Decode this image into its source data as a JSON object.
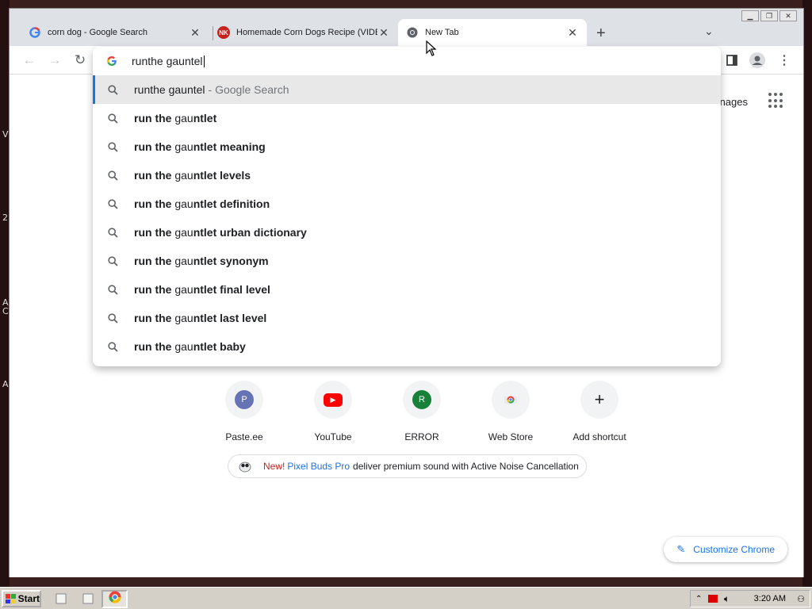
{
  "desktop": {
    "edge_letters": [
      "V",
      "2",
      "A",
      "C",
      "A"
    ]
  },
  "tabs": [
    {
      "title": "corn dog - Google Search",
      "favicon": "google-g-icon"
    },
    {
      "title": "Homemade Corn Dogs Recipe (VIDE",
      "favicon": "nk-favicon-icon",
      "favicon_text": "NK"
    },
    {
      "title": "New Tab",
      "favicon": "chrome-icon"
    }
  ],
  "omnibox": {
    "input_value": "runthe gauntel",
    "first_suggestion": {
      "text": "runthe gauntel",
      "suffix": "- Google Search"
    },
    "suggestions": [
      {
        "bold1": "run the ",
        "norm": "gau",
        "bold2": "ntlet"
      },
      {
        "bold1": "run the ",
        "norm": "gau",
        "bold2": "ntlet meaning"
      },
      {
        "bold1": "run the ",
        "norm": "gau",
        "bold2": "ntlet levels"
      },
      {
        "bold1": "run the ",
        "norm": "gau",
        "bold2": "ntlet definition"
      },
      {
        "bold1": "run the ",
        "norm": "gau",
        "bold2": "ntlet urban dictionary"
      },
      {
        "bold1": "run the ",
        "norm": "gau",
        "bold2": "ntlet synonym"
      },
      {
        "bold1": "run the ",
        "norm": "gau",
        "bold2": "ntlet final level"
      },
      {
        "bold1": "run the ",
        "norm": "gau",
        "bold2": "ntlet last level"
      },
      {
        "bold1": "run the ",
        "norm": "gau",
        "bold2": "ntlet baby"
      }
    ]
  },
  "page": {
    "top_link": "nages",
    "shortcuts": [
      {
        "label": "Paste.ee",
        "icon": "P",
        "color": "#6573b5"
      },
      {
        "label": "YouTube",
        "icon": "▶",
        "color": "#ff0000"
      },
      {
        "label": "ERROR",
        "icon": "R",
        "color": "#188038"
      },
      {
        "label": "Web Store",
        "icon": "",
        "color": "#f1f3f4"
      },
      {
        "label": "Add shortcut",
        "icon": "+",
        "color": "#f1f3f4"
      }
    ],
    "promo": {
      "new": "New!",
      "link": "Pixel Buds Pro",
      "text": "deliver premium sound with Active Noise Cancellation"
    },
    "customize_label": "Customize Chrome"
  },
  "taskbar": {
    "start_label": "Start",
    "clock": "3:20 AM"
  }
}
